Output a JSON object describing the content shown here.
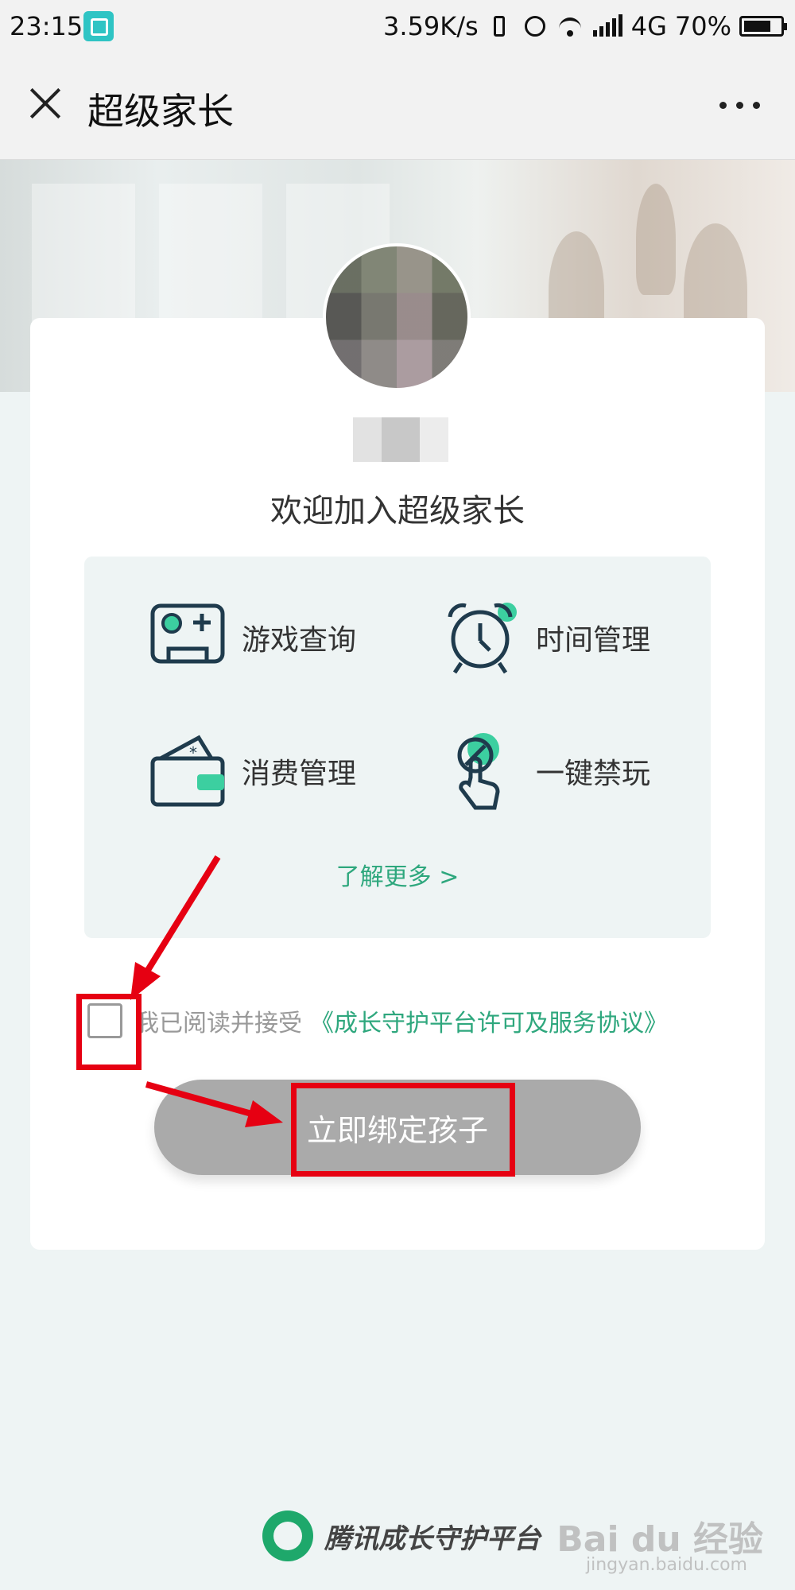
{
  "status_bar": {
    "time": "23:15",
    "net_speed": "3.59K/s",
    "network": "4G",
    "battery": "70%"
  },
  "nav": {
    "title": "超级家长"
  },
  "card": {
    "welcome": "欢迎加入超级家长",
    "features": [
      {
        "label": "游戏查询",
        "icon": "gamepad-icon"
      },
      {
        "label": "时间管理",
        "icon": "alarm-clock-icon"
      },
      {
        "label": "消费管理",
        "icon": "wallet-icon"
      },
      {
        "label": "一键禁玩",
        "icon": "hand-ban-icon"
      }
    ],
    "learn_more": "了解更多 >",
    "agreement_text": "我已阅读并接受",
    "agreement_link": "《成长守护平台许可及服务协议》",
    "bind_button": "立即绑定孩子"
  },
  "footer": {
    "brand": "腾讯成长守护平台"
  },
  "watermark": {
    "text": "Bai du 经验",
    "sub": "jingyan.baidu.com"
  },
  "colors": {
    "accent": "#2ea77d",
    "annotation": "#e60012",
    "button_disabled": "#aaaaaa"
  }
}
